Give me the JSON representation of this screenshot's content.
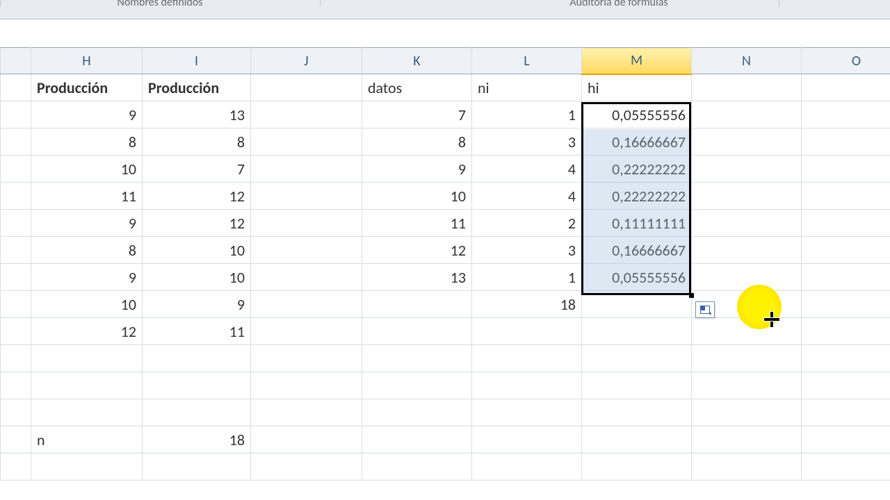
{
  "ribbon": {
    "group_left": "Nombres definidos",
    "group_right": "Auditoría de fórmulas"
  },
  "columns": {
    "rownum": "",
    "H": "H",
    "I": "I",
    "J": "J",
    "K": "K",
    "L": "L",
    "M": "M",
    "N": "N",
    "O": "O"
  },
  "selected_column": "M",
  "headers_row": {
    "H": "Producción",
    "I": "Producción",
    "K": "datos",
    "L": "ni",
    "M": "hi"
  },
  "rows": [
    {
      "H": "9",
      "I": "13",
      "K": "7",
      "L": "1",
      "M": "0,05555556"
    },
    {
      "H": "8",
      "I": "8",
      "K": "8",
      "L": "3",
      "M": "0,16666667"
    },
    {
      "H": "10",
      "I": "7",
      "K": "9",
      "L": "4",
      "M": "0,22222222"
    },
    {
      "H": "11",
      "I": "12",
      "K": "10",
      "L": "4",
      "M": "0,22222222"
    },
    {
      "H": "9",
      "I": "12",
      "K": "11",
      "L": "2",
      "M": "0,11111111"
    },
    {
      "H": "8",
      "I": "10",
      "K": "12",
      "L": "3",
      "M": "0,16666667"
    },
    {
      "H": "9",
      "I": "10",
      "K": "13",
      "L": "1",
      "M": "0,05555556"
    },
    {
      "H": "10",
      "I": "9",
      "K": "",
      "L": "18",
      "M": ""
    },
    {
      "H": "12",
      "I": "11",
      "K": "",
      "L": "",
      "M": ""
    },
    {
      "H": "",
      "I": "",
      "K": "",
      "L": "",
      "M": ""
    },
    {
      "H": "",
      "I": "",
      "K": "",
      "L": "",
      "M": ""
    },
    {
      "H": "",
      "I": "",
      "K": "",
      "L": "",
      "M": ""
    }
  ],
  "n_row": {
    "label": "n",
    "value": "18"
  },
  "colwidths": {
    "rownum": 44,
    "H": 160,
    "I": 156,
    "J": 160,
    "K": 158,
    "L": 158,
    "M": 158,
    "N": 158,
    "O": 158
  }
}
